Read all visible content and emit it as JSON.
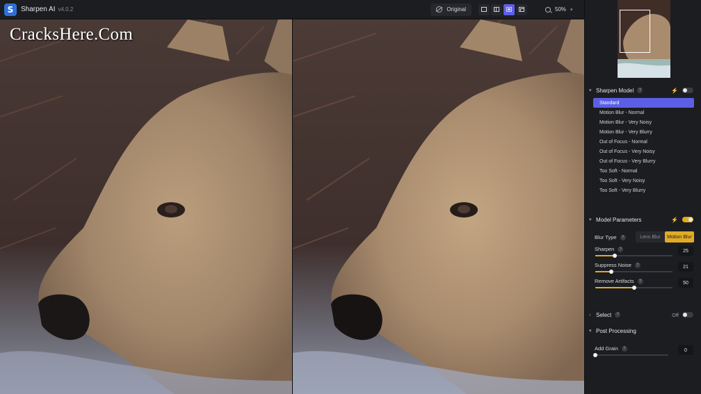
{
  "app": {
    "title": "Sharpen AI",
    "version": "v4.0.2"
  },
  "topbar": {
    "original_label": "Original",
    "view_modes": [
      {
        "icon": "single-view-icon",
        "active": false
      },
      {
        "icon": "split-view-icon",
        "active": false
      },
      {
        "icon": "side-by-side-view-icon",
        "active": true
      },
      {
        "icon": "quad-view-icon",
        "active": false
      }
    ],
    "zoom_level": "50%"
  },
  "watermark": "CracksHere.Com",
  "panel": {
    "sharpen_model": {
      "title": "Sharpen Model",
      "enabled": false,
      "models": [
        {
          "label": "Standard",
          "selected": true
        },
        {
          "label": "Motion Blur - Normal",
          "selected": false
        },
        {
          "label": "Motion Blur - Very Noisy",
          "selected": false
        },
        {
          "label": "Motion Blur - Very Blurry",
          "selected": false
        },
        {
          "label": "Out of Focus - Normal",
          "selected": false
        },
        {
          "label": "Out of Focus - Very Noisy",
          "selected": false
        },
        {
          "label": "Out of Focus - Very Blurry",
          "selected": false
        },
        {
          "label": "Too Soft - Normal",
          "selected": false
        },
        {
          "label": "Too Soft - Very Noisy",
          "selected": false
        },
        {
          "label": "Too Soft - Very Blurry",
          "selected": false
        }
      ]
    },
    "model_parameters": {
      "title": "Model Parameters",
      "auto_enabled": true,
      "blur_type": {
        "label": "Blur Type",
        "options": [
          "Lens Blur",
          "Motion Blur"
        ],
        "selected": "Motion Blur"
      },
      "sliders": [
        {
          "label": "Sharpen",
          "value": "25",
          "fraction": 0.25
        },
        {
          "label": "Suppress Noise",
          "value": "21",
          "fraction": 0.21
        },
        {
          "label": "Remove Artifacts",
          "value": "50",
          "fraction": 0.5
        }
      ]
    },
    "select": {
      "title": "Select",
      "state_label": "Off",
      "enabled": false
    },
    "post_processing": {
      "title": "Post Processing",
      "add_grain": {
        "label": "Add Grain",
        "value": "0",
        "fraction": 0.0
      }
    }
  },
  "colors": {
    "accent": "#5c5fe6",
    "active": "#e0ac24",
    "panel": "#1c1d21"
  }
}
